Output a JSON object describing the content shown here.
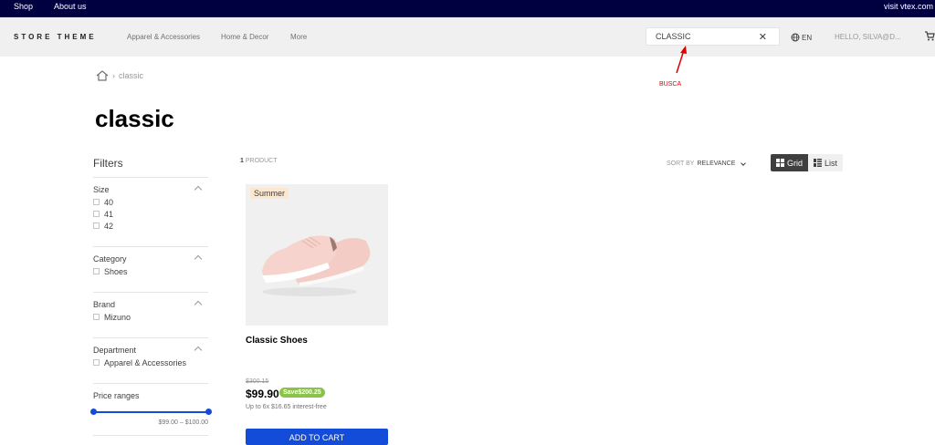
{
  "topbar": {
    "shop": "Shop",
    "about": "About us",
    "visit": "visit vtex.com"
  },
  "header": {
    "logo": "STORE THEME",
    "nav": [
      "Apparel & Accessories",
      "Home & Decor",
      "More"
    ],
    "search_value": "CLASSIC",
    "lang": "EN",
    "hello": "HELLO, SILVA@D..."
  },
  "annotation": "BUSCA",
  "breadcrumb": {
    "current": "classic"
  },
  "title": "classic",
  "filters": {
    "title": "Filters",
    "sections": [
      {
        "name": "Size",
        "options": [
          "40",
          "41",
          "42"
        ]
      },
      {
        "name": "Category",
        "options": [
          "Shoes"
        ]
      },
      {
        "name": "Brand",
        "options": [
          "Mizuno"
        ]
      },
      {
        "name": "Department",
        "options": [
          "Apparel & Accessories"
        ]
      }
    ],
    "price": {
      "name": "Price ranges",
      "label": "$99.00 – $100.00"
    }
  },
  "results": {
    "count": "1",
    "count_label": "PRODUCT"
  },
  "sort": {
    "label": "SORT BY",
    "value": "RELEVANCE"
  },
  "view": {
    "grid": "Grid",
    "list": "List"
  },
  "product": {
    "badge": "Summer",
    "name": "Classic Shoes",
    "list_price": "$300.15",
    "price": "$99.90",
    "save": "Save$200.25",
    "installments": "Up to 6x $16.65 interest-free",
    "cta": "ADD TO CART"
  },
  "colors": {
    "accent": "#134cd8",
    "topbar": "#000040",
    "save": "#8bc34a",
    "badge": "#fde8cf"
  }
}
